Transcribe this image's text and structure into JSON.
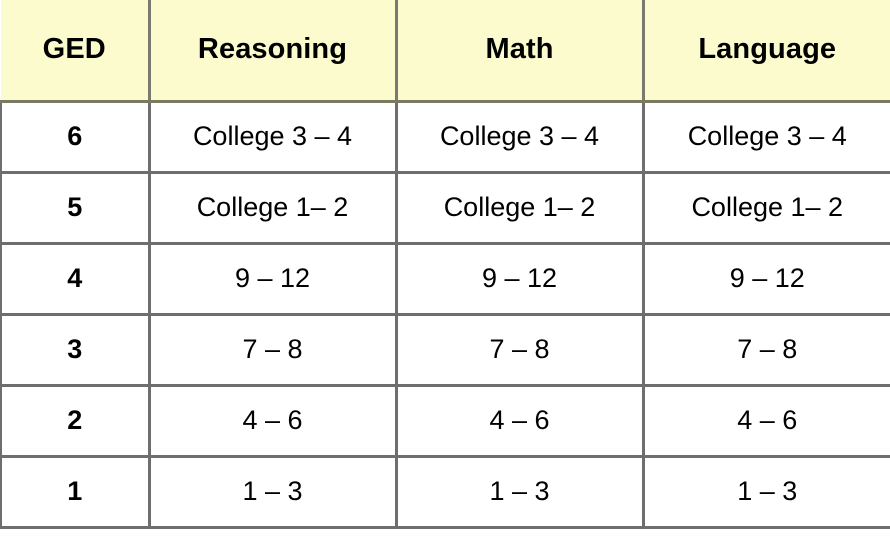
{
  "table": {
    "columns": [
      {
        "key": "ged",
        "label": "GED"
      },
      {
        "key": "reasoning",
        "label": "Reasoning"
      },
      {
        "key": "math",
        "label": "Math"
      },
      {
        "key": "language",
        "label": "Language"
      }
    ],
    "rows": [
      {
        "ged": "6",
        "reasoning": "College 3 – 4",
        "math": "College 3 – 4",
        "language": "College 3 – 4"
      },
      {
        "ged": "5",
        "reasoning": "College 1– 2",
        "math": "College 1– 2",
        "language": "College 1– 2"
      },
      {
        "ged": "4",
        "reasoning": "9 – 12",
        "math": "9 – 12",
        "language": "9 – 12"
      },
      {
        "ged": "3",
        "reasoning": "7 – 8",
        "math": "7 – 8",
        "language": "7 – 8"
      },
      {
        "ged": "2",
        "reasoning": "4 – 6",
        "math": "4 – 6",
        "language": "4 – 6"
      },
      {
        "ged": "1",
        "reasoning": "1 – 3",
        "math": "1 – 3",
        "language": "1 – 3"
      }
    ]
  },
  "colors": {
    "header_background": "#FBFBCD",
    "cell_background": "#FFFFFF",
    "grid_line": "#6E6E6E",
    "header_rule": "#7A7A61",
    "text": "#000000"
  }
}
